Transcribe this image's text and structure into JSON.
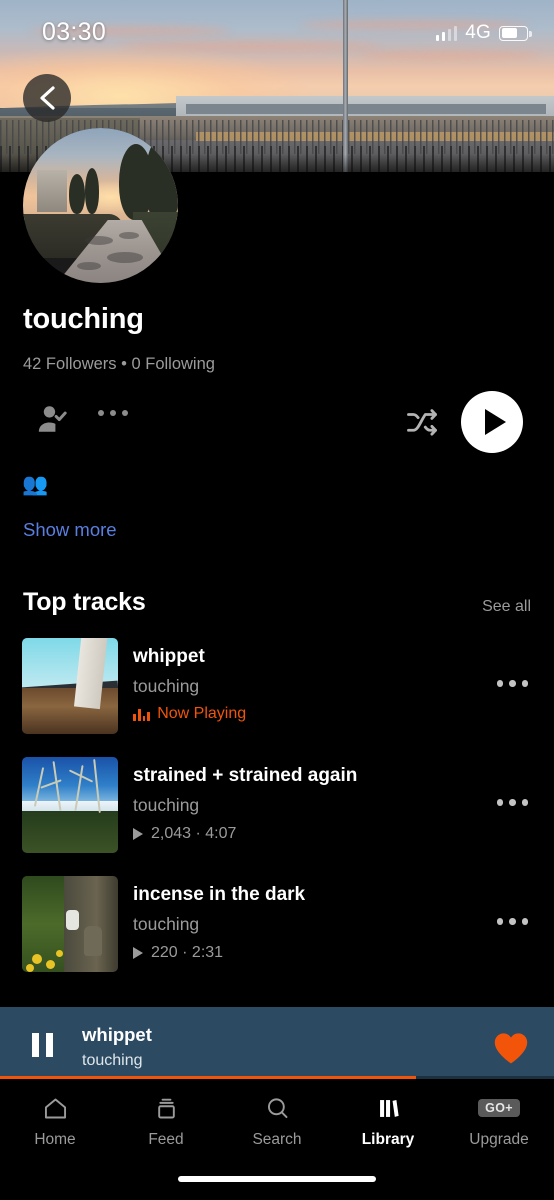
{
  "status_bar": {
    "time": "03:30",
    "network": "4G",
    "signal_bars_filled": 2,
    "signal_bars_total": 4,
    "battery_percent": 58
  },
  "header": {
    "back_icon": "chevron-left-icon",
    "banner_image": "station-sunset-panorama",
    "avatar_image": "country-road-sunset"
  },
  "profile": {
    "username": "touching",
    "stats": "42 Followers • 0 Following",
    "followers_count": "42",
    "following_count": "0",
    "follow_icon": "person-check-icon",
    "more_icon": "more-horizontal-icon",
    "shuffle_icon": "shuffle-icon",
    "play_icon": "play-circle-icon",
    "people_emoji": "👥",
    "show_more_label": "Show more"
  },
  "top_tracks": {
    "heading": "Top tracks",
    "see_all_label": "See all",
    "tracks": [
      {
        "title": "whippet",
        "artist": "touching",
        "status": "Now Playing",
        "is_now_playing": true,
        "artwork": "skylight-window",
        "more_icon": "more-horizontal-icon"
      },
      {
        "title": "strained + strained again",
        "artist": "touching",
        "plays": "2,043",
        "duration": "4:07",
        "meta": "2,043 · 4:07",
        "is_now_playing": false,
        "artwork": "blue-sky-branches",
        "more_icon": "more-horizontal-icon"
      },
      {
        "title": "incense in the dark",
        "artist": "touching",
        "plays": "220",
        "duration": "2:31",
        "meta": "220 · 2:31",
        "is_now_playing": false,
        "artwork": "tree-squirrel-flowers",
        "more_icon": "more-horizontal-icon"
      }
    ]
  },
  "mini_player": {
    "title": "whippet",
    "artist": "touching",
    "pause_icon": "pause-icon",
    "like_icon": "heart-filled-icon",
    "progress_percent": 75,
    "background_color": "#2c4b63",
    "accent_color": "#f2550a"
  },
  "bottom_nav": {
    "items": [
      {
        "label": "Home",
        "icon": "home-icon",
        "active": false
      },
      {
        "label": "Feed",
        "icon": "feed-icon",
        "active": false
      },
      {
        "label": "Search",
        "icon": "search-icon",
        "active": false
      },
      {
        "label": "Library",
        "icon": "library-icon",
        "active": true
      },
      {
        "label": "Upgrade",
        "icon": "go-plus-badge",
        "active": false
      }
    ],
    "go_badge_label": "GO+"
  }
}
